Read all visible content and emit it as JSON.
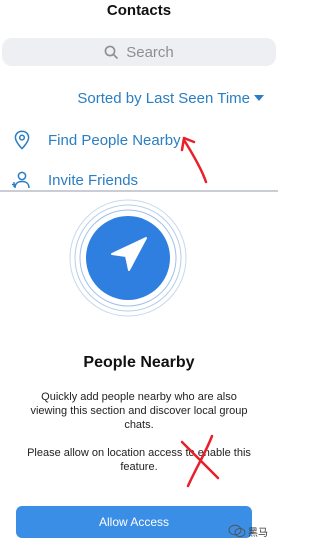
{
  "nav": {
    "title": "Contacts"
  },
  "search": {
    "placeholder": "Search"
  },
  "sort": {
    "label": "Sorted by Last Seen Time"
  },
  "list": {
    "items": [
      {
        "label": "Find People Nearby",
        "icon": "location-pin-icon"
      },
      {
        "label": "Invite Friends",
        "icon": "add-person-icon"
      }
    ]
  },
  "sheet": {
    "title": "People Nearby",
    "description": "Quickly add people nearby who are also viewing this section and discover local group chats.",
    "permission_text": "Please allow on location access to enable this feature.",
    "allow_button": "Allow Access",
    "icon": "navigation-arrow-icon"
  },
  "watermark": {
    "text": "黑马"
  },
  "colors": {
    "accent": "#2a7ec3",
    "button": "#3a8ee6",
    "annotation": "#e8202a"
  }
}
